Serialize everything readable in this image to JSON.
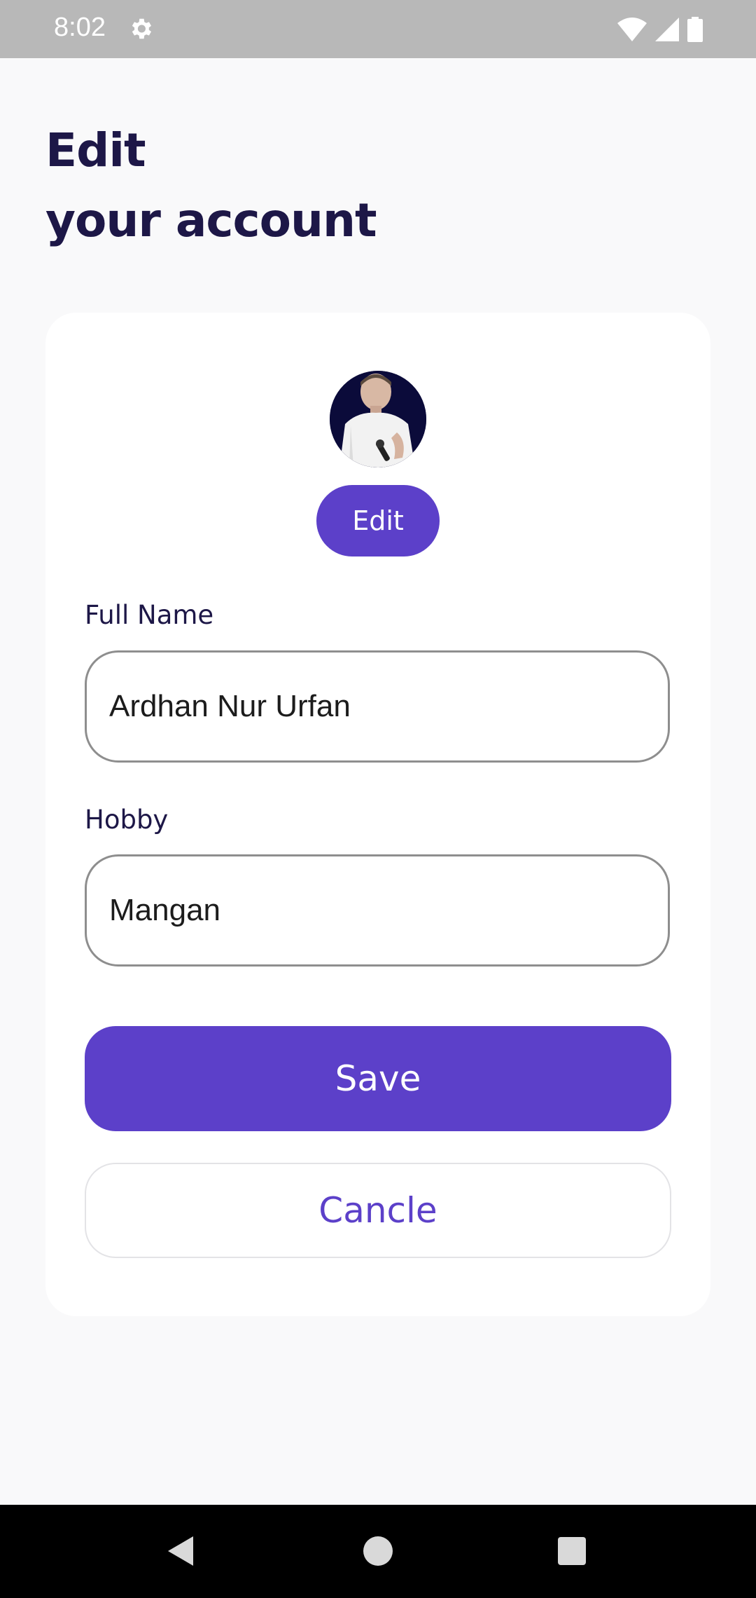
{
  "status_bar": {
    "time": "8:02",
    "icons": [
      "gear-icon",
      "wifi-icon",
      "cell-signal-icon",
      "battery-icon"
    ]
  },
  "header": {
    "title_line1": "Edit",
    "title_line2": "your account"
  },
  "profile": {
    "avatar": "avatar-photo",
    "edit_label": "Edit"
  },
  "form": {
    "full_name": {
      "label": "Full Name",
      "value": "Ardhan Nur Urfan"
    },
    "hobby": {
      "label": "Hobby",
      "value": "Mangan"
    },
    "save_label": "Save",
    "cancel_label": "Cancle"
  },
  "nav_bar": {
    "icons": [
      "back-icon",
      "home-icon",
      "recents-icon"
    ]
  },
  "colors": {
    "accent": "#5c40c9",
    "title": "#1d1747",
    "background": "#f9f9fa",
    "card": "#ffffff",
    "status_bar": "#b8b8b8"
  }
}
